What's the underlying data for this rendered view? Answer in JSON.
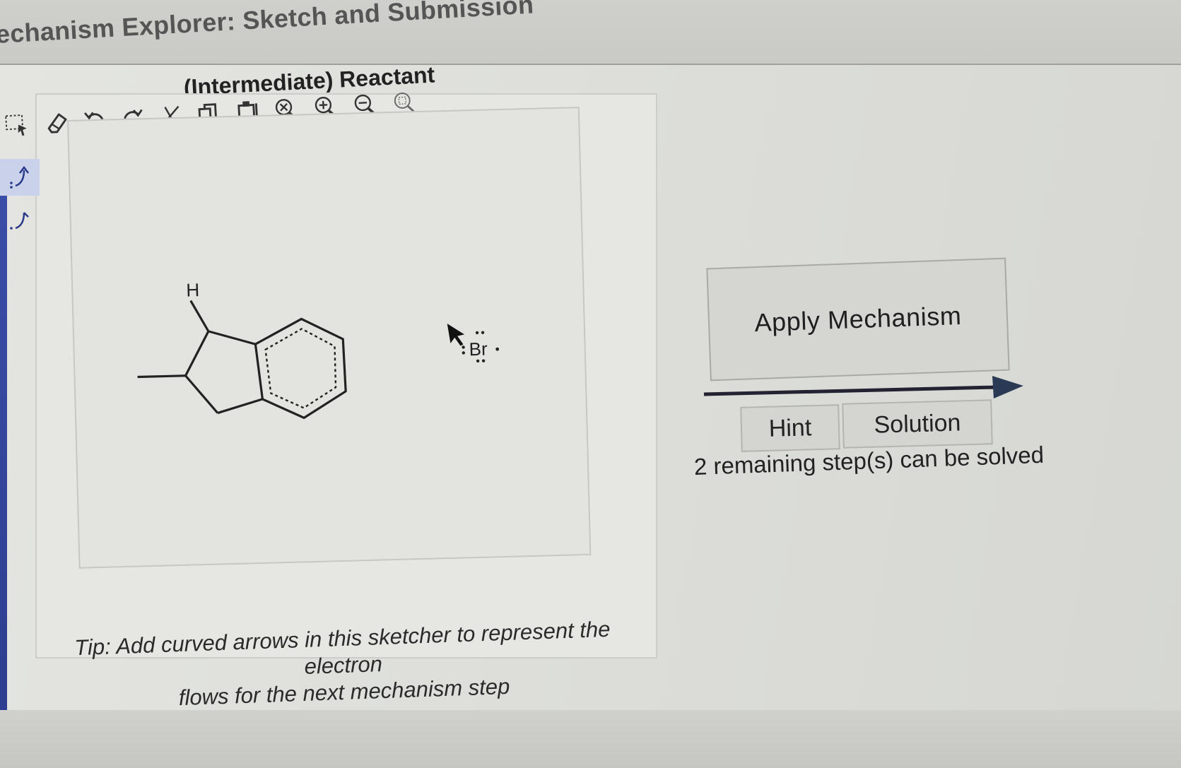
{
  "app": {
    "title": "echanism Explorer: Sketch and Submission"
  },
  "sketcher": {
    "reactant_title": "(Intermediate) Reactant",
    "toolbar": [
      {
        "name": "select-tool",
        "icon": "lasso-select-icon"
      },
      {
        "name": "erase-tool",
        "icon": "eraser-icon"
      },
      {
        "name": "undo-button",
        "icon": "undo-icon"
      },
      {
        "name": "redo-button",
        "icon": "redo-icon"
      },
      {
        "name": "cut-button",
        "icon": "scissors-icon"
      },
      {
        "name": "copy-button",
        "icon": "copy-icon"
      },
      {
        "name": "paste-button",
        "icon": "paste-icon"
      },
      {
        "name": "clear-button",
        "icon": "clear-zoom-icon"
      },
      {
        "name": "zoom-in-button",
        "icon": "zoom-in-icon"
      },
      {
        "name": "zoom-out-button",
        "icon": "zoom-out-icon"
      },
      {
        "name": "zoom-fit-button",
        "icon": "zoom-fit-icon"
      }
    ],
    "side_tools": [
      {
        "name": "curved-arrow-electron-pair-tool",
        "icon": "double-curved-arrow-icon",
        "active": true
      },
      {
        "name": "curved-arrow-single-electron-tool",
        "icon": "single-curved-arrow-icon",
        "active": false
      }
    ],
    "molecule": {
      "hydrogen_label": "H",
      "bromide_label": "Br"
    }
  },
  "mechanism": {
    "apply_label": "Apply Mechanism",
    "hint_label": "Hint",
    "solution_label": "Solution",
    "remaining_text": "2 remaining step(s) can be solved"
  },
  "tip": {
    "line1": "Tip: Add curved arrows in this sketcher to represent the electron",
    "line2": "flows for the next mechanism step"
  },
  "colors": {
    "accent_bar": "#3a4da8",
    "active_tool": "#c9d2ea"
  }
}
